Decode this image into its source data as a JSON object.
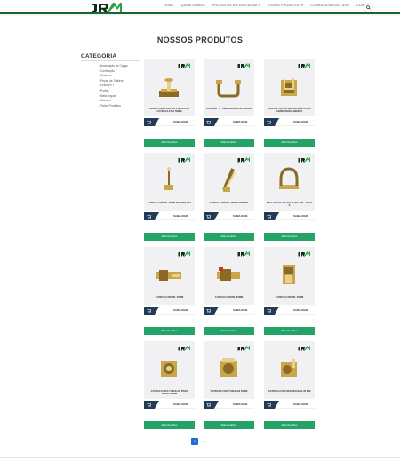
{
  "brand": {
    "logo_text": "JR",
    "tagline": "Ferragens de Aço"
  },
  "nav": [
    {
      "label": "HOME"
    },
    {
      "label": "QUEM SOMOS"
    },
    {
      "label": "PRODUTOS EM DESTAQUE ▾"
    },
    {
      "label": "TODOS PRODUTOS ▾"
    },
    {
      "label": "CONHEÇA NOSSO USO"
    },
    {
      "label": "CONTATO"
    }
  ],
  "page_title": "NOSSOS PRODUTOS",
  "sidebar": {
    "title": "CATEGORIA",
    "items": [
      "Amarração de Carga",
      "Confecção",
      "Diversos",
      "Peças de Trailers",
      "Linha PET",
      "Portas",
      "Meia Argola",
      "Catraca",
      "Todos Produtos"
    ]
  },
  "products": [
    {
      "name": "CHAPA COM PORCA E PARAFUSO CATRACA FIXA 50MM",
      "icon": "plate",
      "saiba": "SAIBA MAIS",
      "more": "Mais Detalhes"
    },
    {
      "name": "ESTRIBO \"U\" AMARRAÇÃO DE CARGA",
      "icon": "u-stirrup",
      "saiba": "SAIBA MAIS",
      "more": "Mais Detalhes"
    },
    {
      "name": "DISPOSITIVO DE AMARRAÇÃO PARA CARROCERIA ABERTA",
      "icon": "box-device",
      "saiba": "SAIBA MAIS",
      "more": "Mais Detalhes"
    },
    {
      "name": "CATRACA MÓVEL 50MM REFORÇADA",
      "icon": "pin",
      "saiba": "SAIBA MAIS",
      "more": "Mais Detalhes"
    },
    {
      "name": "CATRACA MÓVEL 50MM VAREIRA",
      "icon": "lever",
      "saiba": "SAIBA MAIS",
      "more": "Mais Detalhes"
    },
    {
      "name": "MEIA ARGOLA 5' SOLDADA 3/8\" - 3/8 D' S",
      "icon": "d-ring",
      "saiba": "SAIBA MAIS",
      "more": "Mais Detalhes"
    },
    {
      "name": "CATRACA MÓVEL 50MM",
      "icon": "ratchet-long",
      "saiba": "SAIBA MAIS",
      "more": "Mais Detalhes"
    },
    {
      "name": "CATRACA MÓVEL 35MM",
      "icon": "ratchet-red",
      "saiba": "SAIBA MAIS",
      "more": "Mais Detalhes"
    },
    {
      "name": "CATRACA MÓVEL 25MM",
      "icon": "ratchet-small",
      "saiba": "SAIBA MAIS",
      "more": "Mais Detalhes"
    },
    {
      "name": "CATRACA FIXA TUBULAR PARA TRETA 50MM",
      "icon": "ratchet-fixed",
      "saiba": "SAIBA MAIS",
      "more": "Mais Detalhes"
    },
    {
      "name": "CATRACA FIXA TUBULAR 50MM",
      "icon": "ratchet-fixed2",
      "saiba": "SAIBA MAIS",
      "more": "Mais Detalhes"
    },
    {
      "name": "CATRACA FIXA DESTRAVADA 35 MM",
      "icon": "ratchet-fixed3",
      "saiba": "SAIBA MAIS",
      "more": "Mais Detalhes"
    }
  ],
  "pagination": {
    "current": "1",
    "next": "»"
  }
}
